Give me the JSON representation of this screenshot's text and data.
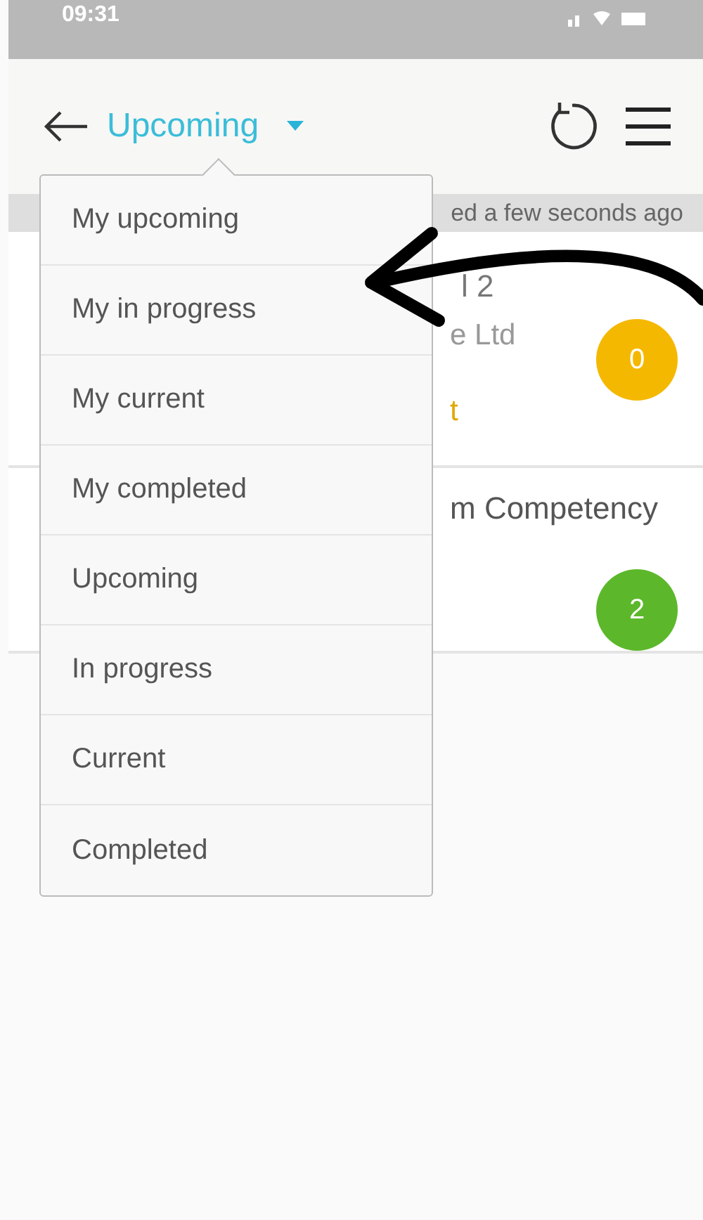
{
  "status_bar": {
    "time": "09:31"
  },
  "header": {
    "title": "Upcoming"
  },
  "sync_note": "ed a few seconds ago",
  "cards": [
    {
      "title": "l 2",
      "subtitle": "e Ltd",
      "status": "t",
      "count": "0",
      "color": "#f5b800"
    },
    {
      "title": "m Competency",
      "count": "2",
      "color": "#5cb82a"
    }
  ],
  "dropdown": {
    "items": [
      {
        "label": "My upcoming"
      },
      {
        "label": "My in progress"
      },
      {
        "label": "My current"
      },
      {
        "label": "My completed"
      },
      {
        "label": "Upcoming"
      },
      {
        "label": "In progress"
      },
      {
        "label": "Current"
      },
      {
        "label": "Completed"
      }
    ]
  }
}
